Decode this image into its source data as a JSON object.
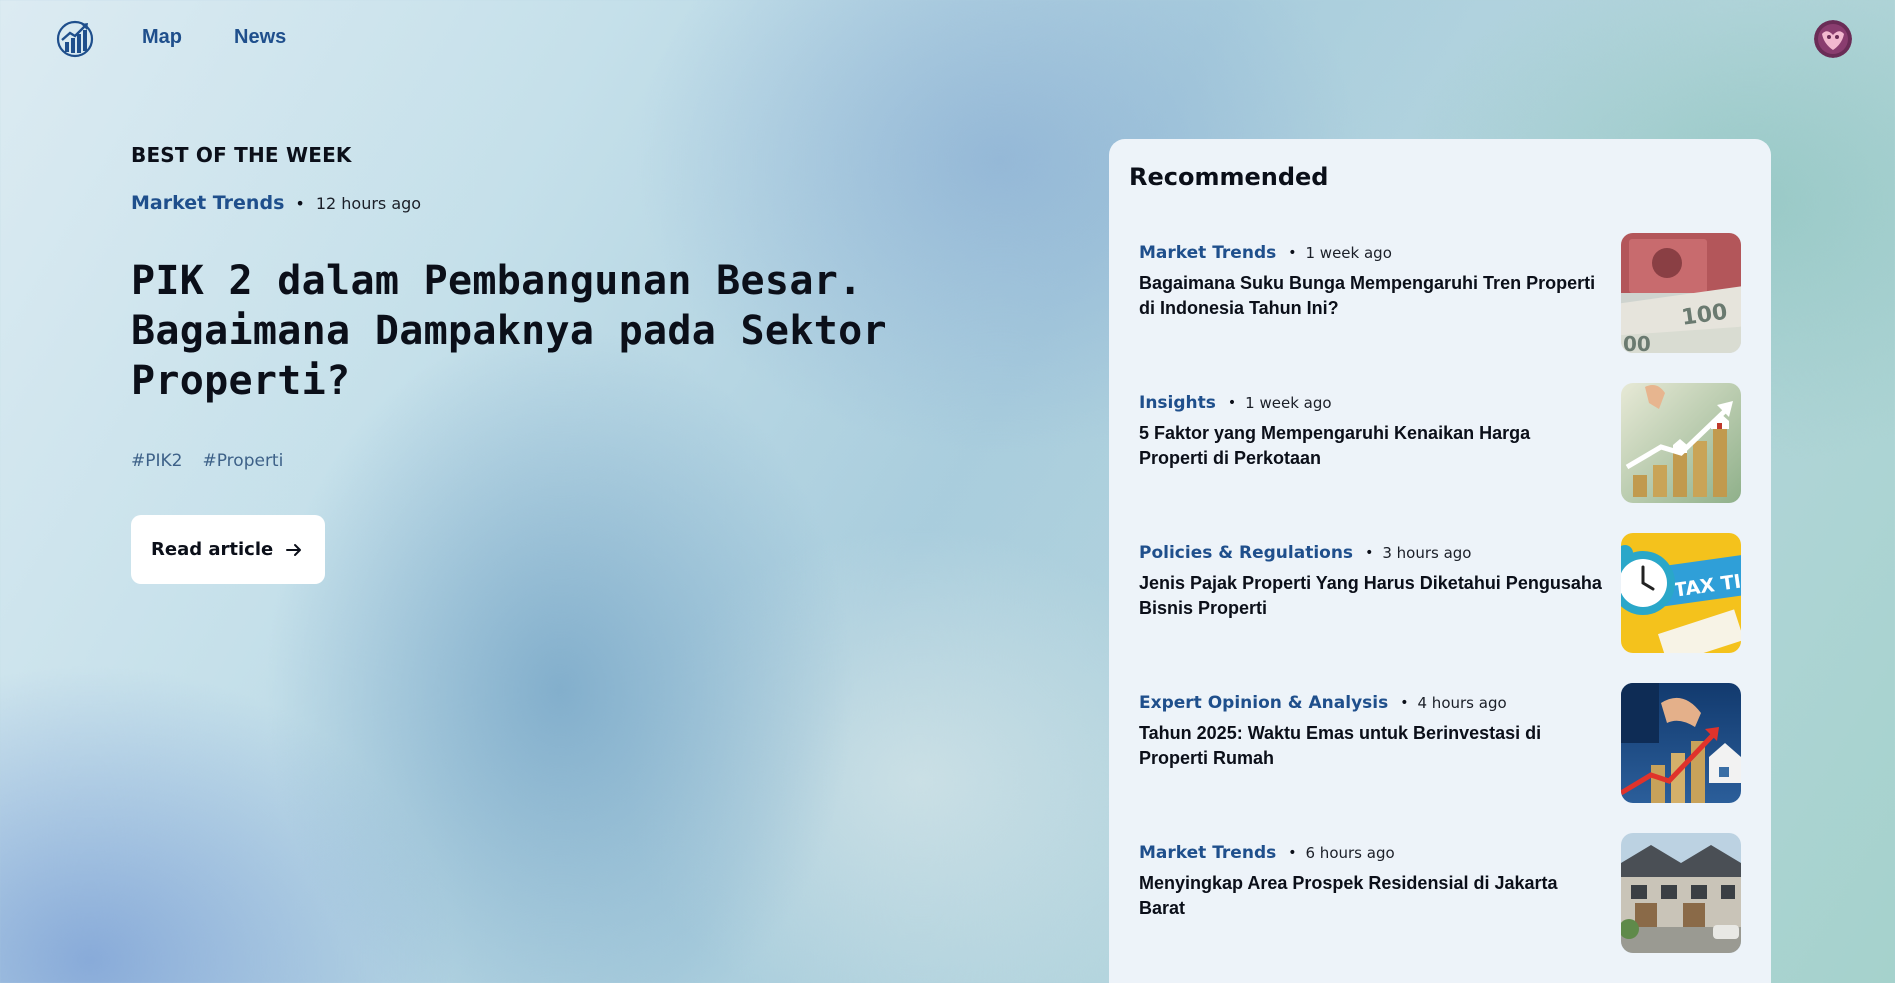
{
  "nav": {
    "logo_icon": "growth-chart-logo-icon",
    "links": [
      "Map",
      "News"
    ],
    "avatar_icon": "user-avatar-icon"
  },
  "hero": {
    "eyebrow": "BEST OF THE WEEK",
    "category": "Market Trends",
    "separator": "•",
    "time": "12 hours ago",
    "title": "PIK 2 dalam Pembangunan Besar. Bagaimana Dampaknya pada Sektor Properti?",
    "tags": [
      "#PIK2",
      "#Properti"
    ],
    "button_label": "Read article",
    "button_icon": "arrow-right-icon"
  },
  "recommended": {
    "title": "Recommended",
    "separator": "•",
    "items": [
      {
        "category": "Market Trends",
        "time": "1 week ago",
        "title": "Bagaimana Suku Bunga Mempengaruhi Tren Properti di Indonesia Tahun Ini?",
        "thumb_icon": "banknotes-thumbnail"
      },
      {
        "category": "Insights",
        "time": "1 week ago",
        "title": "5 Faktor yang Mempengaruhi Kenaikan Harga Properti di Perkotaan",
        "thumb_icon": "coin-stacks-houses-thumbnail"
      },
      {
        "category": "Policies & Regulations",
        "time": "3 hours ago",
        "title": "Jenis Pajak Properti Yang Harus Diketahui Pengusaha Bisnis Properti",
        "thumb_icon": "tax-time-clock-thumbnail",
        "thumb_text": "TAX TIME"
      },
      {
        "category": "Expert Opinion & Analysis",
        "time": "4 hours ago",
        "title": "Tahun 2025: Waktu Emas untuk Berinvestasi di Properti Rumah",
        "thumb_icon": "investment-growth-thumbnail"
      },
      {
        "category": "Market Trends",
        "time": "6 hours ago",
        "title": "Menyingkap Area Prospek Residensial di Jakarta Barat",
        "thumb_icon": "townhouses-thumbnail"
      }
    ]
  },
  "colors": {
    "accent": "#1f4f8c",
    "tag": "#3d6188",
    "panel": "#edf3f9",
    "text": "#0b0f19"
  }
}
